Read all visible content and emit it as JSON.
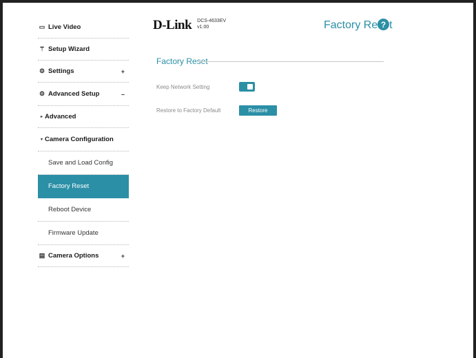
{
  "sidebar": {
    "live_video": "Live Video",
    "setup_wizard": "Setup Wizard",
    "settings": "Settings",
    "advanced_setup": "Advanced Setup",
    "advanced": "Advanced",
    "camera_configuration": "Camera Configuration",
    "save_load_config": "Save and Load Config",
    "factory_reset": "Factory Reset",
    "reboot_device": "Reboot Device",
    "firmware_update": "Firmware Update",
    "camera_options": "Camera Options",
    "expand_symbol": "+",
    "collapse_symbol": "–"
  },
  "header": {
    "brand": "D-Link",
    "model": "DCS-4633EV",
    "version": "v1.00",
    "page_title": "Factory Reset",
    "help_symbol": "?"
  },
  "main": {
    "section_title": "Factory Reset",
    "keep_network_label": "Keep Network Setting",
    "keep_network_enabled": true,
    "restore_label": "Restore to Factory Default",
    "restore_button": "Restore"
  },
  "colors": {
    "accent": "#2b8fa6"
  },
  "icons": {
    "live_video": "video-icon",
    "setup_wizard": "wand-icon",
    "settings": "gear-icon",
    "advanced_setup": "advanced-gear-icon",
    "camera_options": "document-icon",
    "help": "help-icon"
  }
}
